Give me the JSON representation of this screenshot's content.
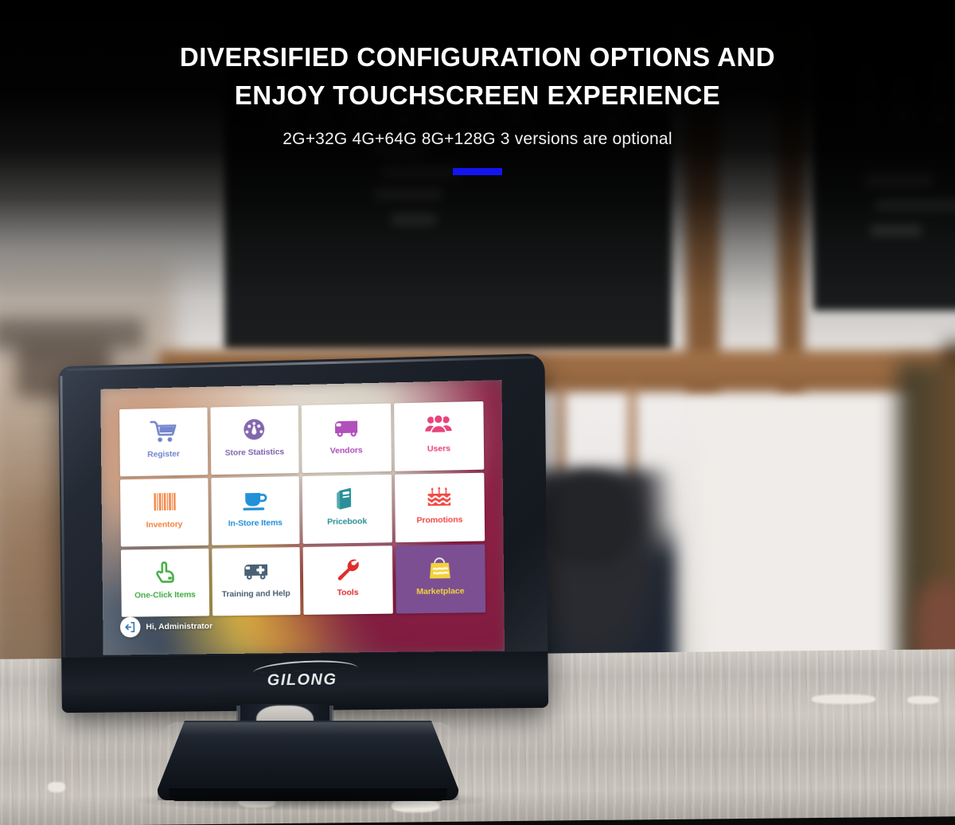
{
  "header": {
    "title_line1": "DIVERSIFIED CONFIGURATION OPTIONS AND",
    "title_line2": "ENJOY TOUCHSCREEN EXPERIENCE",
    "subtitle": "2G+32G 4G+64G 8G+128G 3 versions are optional",
    "accent_color": "#1414f0"
  },
  "device": {
    "brand": "GILONG",
    "bezel_color": "#1a1f27"
  },
  "pos_screen": {
    "tiles": [
      {
        "label": "Register",
        "icon": "shopping-cart-icon",
        "color": "#5b6fc4",
        "tile_bg": "#ffffff"
      },
      {
        "label": "Store Statistics",
        "icon": "gauge-icon",
        "color": "#7a5ca8",
        "tile_bg": "#ffffff"
      },
      {
        "label": "Vendors",
        "icon": "delivery-truck-icon",
        "color": "#b14fbb",
        "tile_bg": "#ffffff"
      },
      {
        "label": "Users",
        "icon": "users-group-icon",
        "color": "#e8437c",
        "tile_bg": "#ffffff"
      },
      {
        "label": "Inventory",
        "icon": "barcode-icon",
        "color": "#f2752b",
        "tile_bg": "#ffffff"
      },
      {
        "label": "In-Store Items",
        "icon": "coffee-cup-icon",
        "color": "#1f8fd6",
        "tile_bg": "#ffffff"
      },
      {
        "label": "Pricebook",
        "icon": "book-icon",
        "color": "#2a9099",
        "tile_bg": "#ffffff"
      },
      {
        "label": "Promotions",
        "icon": "birthday-cake-icon",
        "color": "#f04a46",
        "tile_bg": "#ffffff"
      },
      {
        "label": "One-Click Items",
        "icon": "pointing-hand-icon",
        "color": "#3aa93a",
        "tile_bg": "#ffffff"
      },
      {
        "label": "Training and Help",
        "icon": "ambulance-icon",
        "color": "#4a6075",
        "tile_bg": "#ffffff"
      },
      {
        "label": "Tools",
        "icon": "wrench-icon",
        "color": "#e02d2d",
        "tile_bg": "#ffffff"
      },
      {
        "label": "Marketplace",
        "icon": "shopping-bag-icon",
        "color": "#f2d23c",
        "tile_bg": "#7b4f92"
      }
    ],
    "status": {
      "greeting": "Hi, Administrator",
      "avatar_icon": "sign-out-icon"
    }
  }
}
